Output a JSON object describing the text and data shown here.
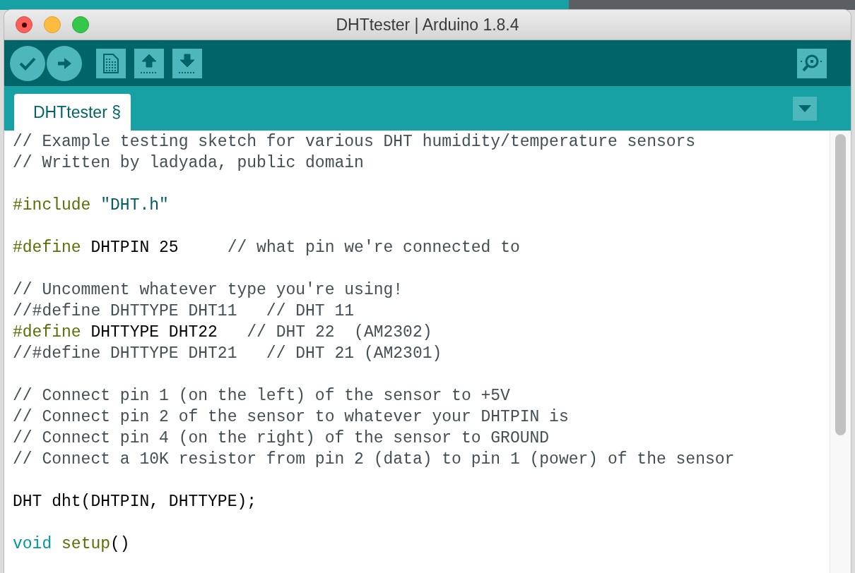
{
  "window": {
    "title": "DHTtester | Arduino 1.8.4"
  },
  "toolbar": {
    "buttons": [
      {
        "kind": "verify"
      },
      {
        "kind": "upload"
      },
      {
        "kind": "new"
      },
      {
        "kind": "open"
      },
      {
        "kind": "save"
      }
    ],
    "right_buttons": [
      {
        "kind": "serial"
      }
    ]
  },
  "tabs": [
    {
      "label": "DHTtester §",
      "selected": true
    }
  ],
  "editor": {
    "blocks": [
      [
        [
          {
            "text": "// Example testing sketch for various DHT humidity/temperature sensors",
            "kind": "comment"
          }
        ],
        [
          {
            "text": "// Written by ladyada, public domain",
            "kind": "comment"
          }
        ]
      ],
      [
        [
          {
            "text": "#include ",
            "kind": "preprocessor"
          },
          {
            "text": "\"DHT.h\"",
            "kind": "string"
          }
        ]
      ],
      [
        [
          {
            "text": "#define",
            "kind": "preprocessor"
          },
          {
            "text": " DHTPIN 25     ",
            "kind": "plain"
          },
          {
            "text": "// what pin we're connected to",
            "kind": "comment"
          }
        ]
      ],
      [
        [
          {
            "text": "// Uncomment whatever type you're using!",
            "kind": "comment"
          }
        ],
        [
          {
            "text": "//#define DHTTYPE DHT11   // DHT 11",
            "kind": "comment"
          }
        ],
        [
          {
            "text": "#define",
            "kind": "preprocessor"
          },
          {
            "text": " DHTTYPE DHT22   ",
            "kind": "plain"
          },
          {
            "text": "// DHT 22  (AM2302)",
            "kind": "comment"
          }
        ],
        [
          {
            "text": "//#define DHTTYPE DHT21   // DHT 21 (AM2301)",
            "kind": "comment"
          }
        ]
      ],
      [
        [
          {
            "text": "// Connect pin 1 (on the left) of the sensor to +5V",
            "kind": "comment"
          }
        ],
        [
          {
            "text": "// Connect pin 2 of the sensor to whatever your DHTPIN is",
            "kind": "comment"
          }
        ],
        [
          {
            "text": "// Connect pin 4 (on the right) of the sensor to GROUND",
            "kind": "comment"
          }
        ],
        [
          {
            "text": "// Connect a 10K resistor from pin 2 (data) to pin 1 (power) of the sensor",
            "kind": "comment"
          }
        ]
      ],
      [
        [
          {
            "text": "DHT dht(DHTPIN, DHTTYPE);",
            "kind": "plain"
          }
        ]
      ],
      [
        [
          {
            "text": "void",
            "kind": "type"
          },
          {
            "text": " setup",
            "kind": "function"
          },
          {
            "text": "()",
            "kind": "plain"
          }
        ]
      ]
    ]
  }
}
